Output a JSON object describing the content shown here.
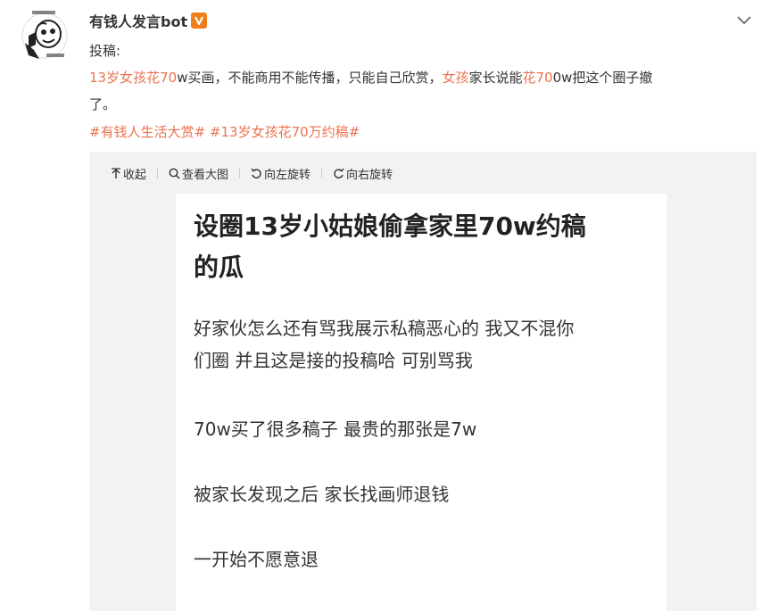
{
  "author": {
    "name": "有钱人发言bot",
    "badge_icon": "vip-v-badge-icon",
    "badge_color": "#f07e1a"
  },
  "post": {
    "line1": "投稿:",
    "line2": [
      {
        "text": "13岁女孩花70",
        "hl": true
      },
      {
        "text": "w买画，不能商用不能传播，只能自己欣赏，",
        "hl": false
      },
      {
        "text": "女孩",
        "hl": true
      },
      {
        "text": "家长说能",
        "hl": false
      },
      {
        "text": "花70",
        "hl": true
      },
      {
        "text": "0w把这个圈子撤",
        "hl": false
      }
    ],
    "line3": "了。",
    "highlight_color": "#eb7350",
    "tags": [
      "#有钱人生活大赏#",
      "#13岁女孩花70万约稿#"
    ]
  },
  "toolbar": {
    "collapse": "收起",
    "view_large": "查看大图",
    "rotate_left": "向左旋转",
    "rotate_right": "向右旋转"
  },
  "image": {
    "title_line1": "设圈13岁小姑娘偷拿家里70w约稿",
    "title_line2": "的瓜",
    "p1_line1": "好家伙怎么还有骂我展示私稿恶心的 我又不混你",
    "p1_line2": "们圈 并且这是接的投稿哈 可别骂我",
    "p2": "70w买了很多稿子 最贵的那张是7w",
    "p3": "被家长发现之后 家长找画师退钱",
    "p4": "一开始不愿意退"
  }
}
